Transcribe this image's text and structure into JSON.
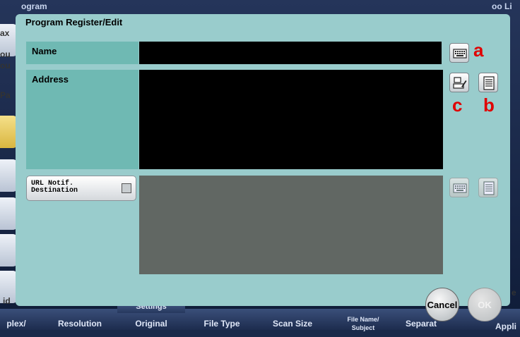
{
  "dialog": {
    "title": "Program Register/Edit",
    "name_label": "Name",
    "address_label": "Address",
    "url_notif_label": "URL Notif.\nDestination",
    "cancel_label": "Cancel",
    "ok_label": "OK"
  },
  "markers": {
    "a": "a",
    "b": "b",
    "c": "c"
  },
  "background": {
    "top_left": "ogram",
    "top_right": "oo Li",
    "left_frags": [
      "ax",
      "ou",
      "ou",
      "Pa",
      "id"
    ],
    "right_frag": "e",
    "settings_label": "Settings",
    "bottom_tabs": [
      "plex/",
      "Resolution",
      "Original",
      "File Type",
      "Scan Size",
      "File Name/\nSubject",
      "Separat",
      "Appli"
    ]
  },
  "icons": {
    "name_keyboard": "keyboard-icon",
    "address_direct": "direct-input-icon",
    "address_book": "address-book-icon",
    "url_keyboard": "keyboard-icon",
    "url_book": "address-book-icon"
  },
  "colors": {
    "dialog_bg": "#99cccc",
    "label_bg": "#6fb9b3",
    "field_bg": "#000000",
    "disabled_field_bg": "#616763",
    "marker": "#e00000"
  }
}
